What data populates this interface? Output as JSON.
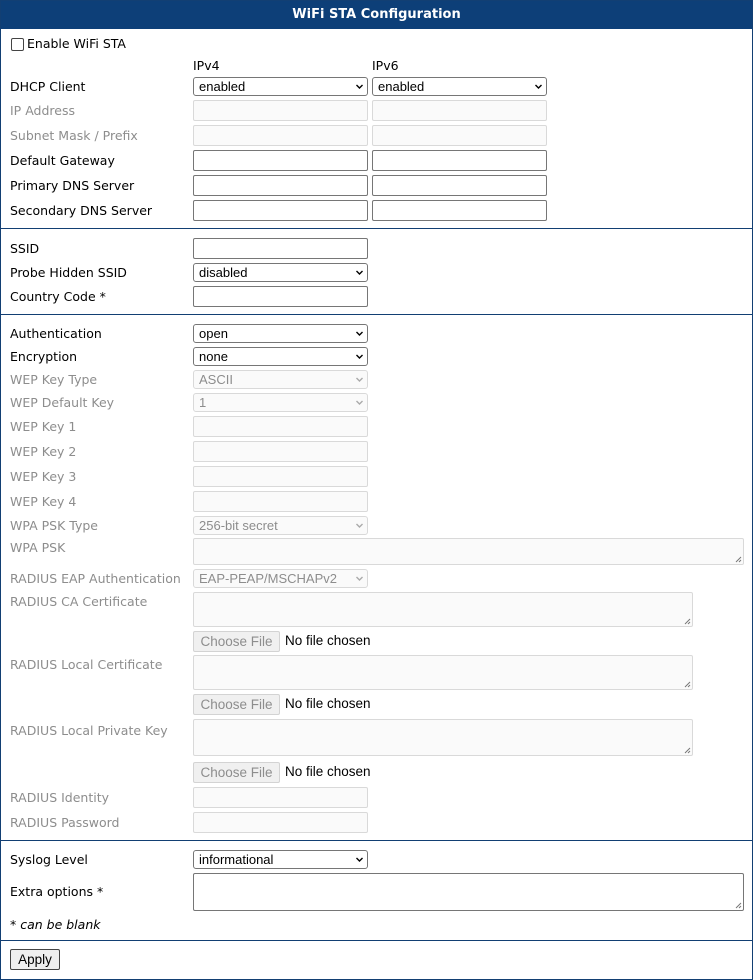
{
  "header": {
    "title": "WiFi STA Configuration"
  },
  "enable": {
    "label": "Enable WiFi STA"
  },
  "columns": {
    "ipv4": "IPv4",
    "ipv6": "IPv6"
  },
  "network": {
    "dhcp_client": "DHCP Client",
    "dhcp_ipv4_value": "enabled",
    "dhcp_ipv6_value": "enabled",
    "ip_address": "IP Address",
    "subnet_mask": "Subnet Mask / Prefix",
    "default_gateway": "Default Gateway",
    "primary_dns": "Primary DNS Server",
    "secondary_dns": "Secondary DNS Server"
  },
  "wifi": {
    "ssid": "SSID",
    "probe_hidden_ssid": "Probe Hidden SSID",
    "probe_hidden_value": "disabled",
    "country_code": "Country Code *"
  },
  "security": {
    "authentication": "Authentication",
    "authentication_value": "open",
    "encryption": "Encryption",
    "encryption_value": "none",
    "wep_key_type": "WEP Key Type",
    "wep_key_type_value": "ASCII",
    "wep_default_key": "WEP Default Key",
    "wep_default_key_value": "1",
    "wep_key_1": "WEP Key 1",
    "wep_key_2": "WEP Key 2",
    "wep_key_3": "WEP Key 3",
    "wep_key_4": "WEP Key 4",
    "wpa_psk_type": "WPA PSK Type",
    "wpa_psk_type_value": "256-bit secret",
    "wpa_psk": "WPA PSK",
    "radius_eap_auth": "RADIUS EAP Authentication",
    "radius_eap_auth_value": "EAP-PEAP/MSCHAPv2",
    "radius_ca_cert": "RADIUS CA Certificate",
    "radius_local_cert": "RADIUS Local Certificate",
    "radius_local_key": "RADIUS Local Private Key",
    "radius_identity": "RADIUS Identity",
    "radius_password": "RADIUS Password",
    "choose_file": "Choose File",
    "no_file": "No file chosen"
  },
  "misc": {
    "syslog_level": "Syslog Level",
    "syslog_level_value": "informational",
    "extra_options": "Extra options *",
    "note": "* can be blank"
  },
  "footer": {
    "apply": "Apply"
  },
  "colors": {
    "header_bg": "#0d3f78",
    "border": "#123f73",
    "disabled_text": "#8d8d8d"
  }
}
